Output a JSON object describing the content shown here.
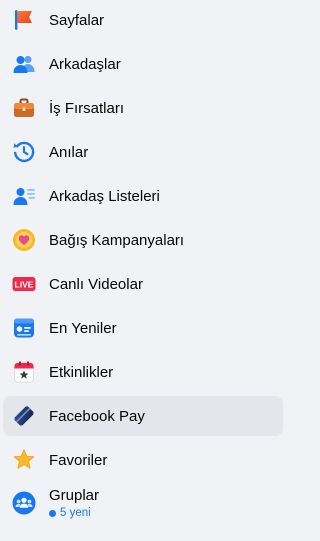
{
  "menu": {
    "items": [
      {
        "label": "Sayfalar",
        "icon": "flag-icon"
      },
      {
        "label": "Arkadaşlar",
        "icon": "friends-icon"
      },
      {
        "label": "İş Fırsatları",
        "icon": "briefcase-icon"
      },
      {
        "label": "Anılar",
        "icon": "memories-clock-icon"
      },
      {
        "label": "Arkadaş Listeleri",
        "icon": "friend-lists-icon"
      },
      {
        "label": "Bağış Kampanyaları",
        "icon": "fundraiser-heart-icon"
      },
      {
        "label": "Canlı Videolar",
        "icon": "live-icon",
        "badge": "LIVE"
      },
      {
        "label": "En Yeniler",
        "icon": "newsfeed-icon"
      },
      {
        "label": "Etkinlikler",
        "icon": "calendar-star-icon"
      },
      {
        "label": "Facebook Pay",
        "icon": "payment-card-icon",
        "active": true
      },
      {
        "label": "Favoriler",
        "icon": "star-icon"
      },
      {
        "label": "Gruplar",
        "icon": "groups-icon",
        "sub": "5 yeni"
      }
    ]
  },
  "colors": {
    "background": "#f0f2f5",
    "active_row": "#e4e6eb",
    "accent": "#1877f2",
    "text": "#050505"
  }
}
